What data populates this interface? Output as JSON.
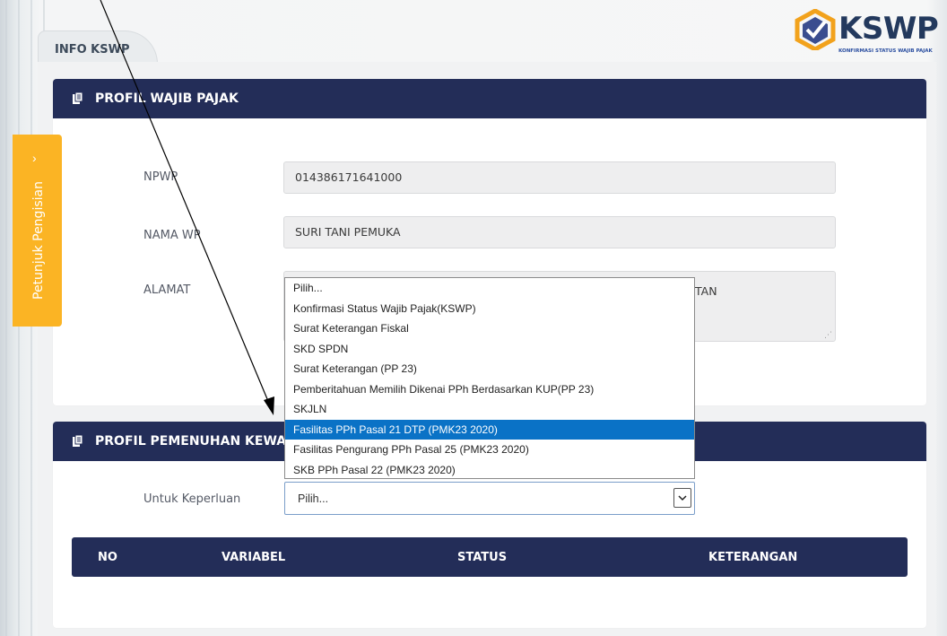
{
  "tab": {
    "label": "INFO KSWP"
  },
  "logo": {
    "text": "KSWP",
    "subtitle": "KONFIRMASI STATUS WAJIB PAJAK",
    "icon": "check-hexagon-icon"
  },
  "side_tab": {
    "label": "Petunjuk Pengisian",
    "chevron": "›"
  },
  "profil": {
    "title": "PROFIL WAJIB PAJAK",
    "npwp_label": "NPWP",
    "npwp_value": "014386171641000",
    "nama_label": "NAMA WP",
    "nama_value": "SURI TANI PEMUKA",
    "alamat_label": "ALAMAT",
    "alamat_partial": "TAN"
  },
  "pemenuhan": {
    "title": "PROFIL PEMENUHAN KEWAJIBAN",
    "keperluan_label": "Untuk Keperluan",
    "keperluan_selected": "Pilih..."
  },
  "dropdown": {
    "options": [
      "Pilih...",
      "Konfirmasi Status Wajib Pajak(KSWP)",
      "Surat Keterangan Fiskal",
      "SKD SPDN",
      "Surat Keterangan (PP 23)",
      "Pemberitahuan Memilih Dikenai PPh Berdasarkan KUP(PP 23)",
      "SKJLN",
      "Fasilitas PPh Pasal 21 DTP (PMK23 2020)",
      "Fasilitas Pengurang PPh Pasal 25 (PMK23 2020)",
      "SKB PPh Pasal 22 (PMK23 2020)"
    ],
    "highlighted_index": 7
  },
  "table": {
    "headers": {
      "no": "NO",
      "variabel": "VARIABEL",
      "status": "STATUS",
      "keterangan": "KETERANGAN"
    }
  },
  "colors": {
    "header_navy": "#232d58",
    "side_tab": "#fbb424",
    "highlight": "#0a72c6"
  }
}
